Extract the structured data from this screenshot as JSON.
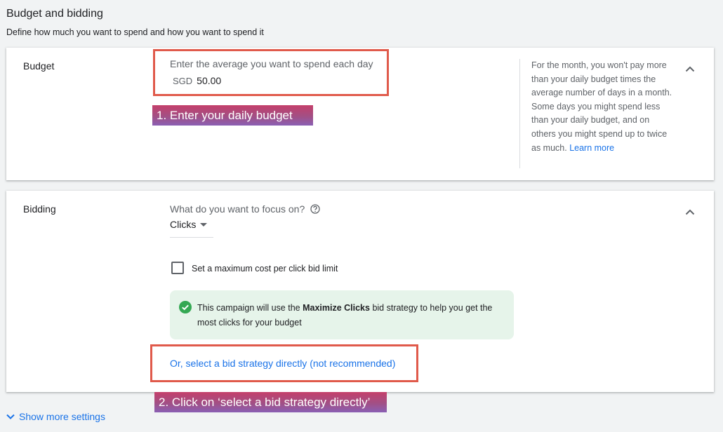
{
  "header": {
    "title": "Budget and bidding",
    "subtitle": "Define how much you want to spend and how you want to spend it"
  },
  "budget": {
    "section_title": "Budget",
    "field_label": "Enter the average you want to spend each day",
    "currency": "SGD",
    "amount": "50.00",
    "help_text": "For the month, you won't pay more than your daily budget times the average number of days in a month. Some days you might spend less than your daily budget, and on others you might spend up to twice as much.",
    "learn_more": "Learn more",
    "annotation": "1.  Enter your daily budget"
  },
  "bidding": {
    "section_title": "Bidding",
    "focus_question": "What do you want to focus on?",
    "focus_value": "Clicks",
    "checkbox_label": "Set a maximum cost per click bid limit",
    "info_prefix": "This campaign will use the ",
    "info_bold": "Maximize Clicks",
    "info_suffix": " bid strategy to help you get the most clicks for your budget",
    "strategy_link": "Or, select a bid strategy directly (not recommended)",
    "annotation": "2. Click on ‘select a bid strategy directly’"
  },
  "footer": {
    "show_more": "Show more settings"
  },
  "colors": {
    "link": "#1a73e8",
    "success": "#34a853",
    "annotation_border": "#e05a4b"
  }
}
